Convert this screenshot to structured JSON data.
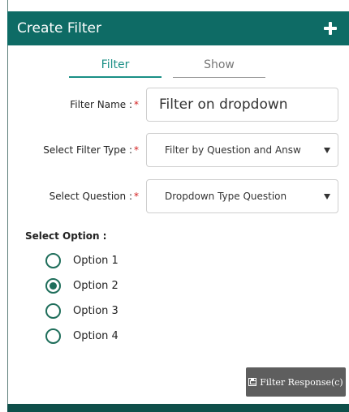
{
  "header": {
    "title": "Create Filter",
    "add_icon": "plus-icon"
  },
  "tabs": [
    {
      "label": "Filter",
      "active": true
    },
    {
      "label": "Show",
      "active": false
    }
  ],
  "form": {
    "filter_name": {
      "label": "Filter Name :",
      "required_mark": "*",
      "value": "Filter on dropdown"
    },
    "filter_type": {
      "label": "Select Filter Type :",
      "required_mark": "*",
      "value": "Filter by Question and Answ"
    },
    "question": {
      "label": "Select Question :",
      "required_mark": "*",
      "value": "Dropdown Type Question"
    }
  },
  "select_option": {
    "title": "Select Option :",
    "options": [
      {
        "label": "Option 1",
        "checked": false
      },
      {
        "label": "Option 2",
        "checked": true
      },
      {
        "label": "Option 3",
        "checked": false
      },
      {
        "label": "Option 4",
        "checked": false
      }
    ]
  },
  "submit": {
    "label": "Filter Response(c)",
    "icon": "save-icon"
  },
  "colors": {
    "header_bg": "#0e6b65",
    "accent": "#1a8f86",
    "radio": "#1f6e5b",
    "required": "#d32020",
    "button_bg": "#5e5e5e"
  }
}
